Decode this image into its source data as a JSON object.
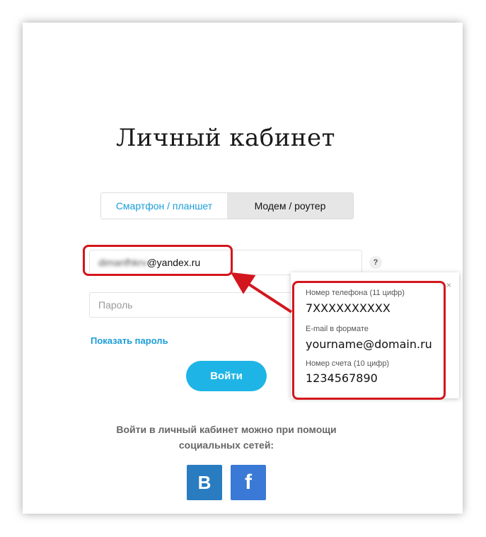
{
  "page": {
    "title": "Личный кабинет"
  },
  "tabs": [
    {
      "label": "Смартфон / планшет",
      "active": true
    },
    {
      "label": "Модем / роутер",
      "active": false
    }
  ],
  "login": {
    "value_blurred": "dimanfhkrv",
    "value_visible": "@yandex.ru"
  },
  "password": {
    "placeholder": "Пароль"
  },
  "help_icon": "?",
  "show_password_label": "Показать пароль",
  "submit_label": "Войти",
  "social": {
    "text": "Войти в личный кабинет можно при помощи социальных сетей:",
    "vk_label": "B",
    "fb_label": "f"
  },
  "tooltip": {
    "close": "×",
    "phone_label": "Номер телефона (11 цифр)",
    "phone_value": "7XXXXXXXXXX",
    "email_label": "E-mail в формате",
    "email_value": "yourname@domain.ru",
    "account_label": "Номер счета (10 цифр)",
    "account_value": "1234567890"
  },
  "colors": {
    "accent": "#1a9dd9",
    "button": "#1eb5e6",
    "highlight": "#d3161d",
    "vk": "#2a7cc0",
    "fb": "#3a79d6"
  }
}
